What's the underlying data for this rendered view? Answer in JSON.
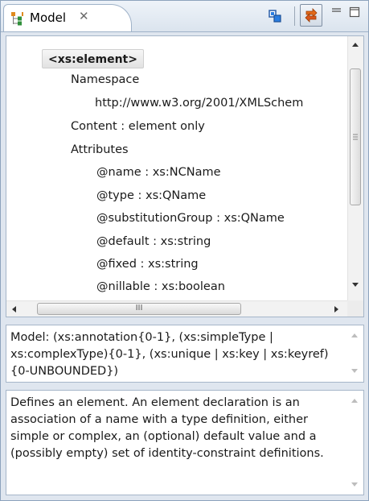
{
  "window": {
    "tab_title": "Model",
    "tab_close_glyph": "✕",
    "tab_icon": "model-tree-icon"
  },
  "toolbar": {
    "link_icon": "link-with-editor-icon",
    "sync_icon": "synchronize-icon",
    "minimize_icon": "minimize-icon",
    "maximize_icon": "maximize-icon"
  },
  "tree": {
    "root": "<xs:element>",
    "namespace_label": "Namespace",
    "namespace_value": "http://www.w3.org/2001/XMLSchem",
    "content": "Content : element only",
    "attributes_label": "Attributes",
    "attributes": [
      "@name : xs:NCName",
      "@type : xs:QName",
      "@substitutionGroup : xs:QName",
      "@default : xs:string",
      "@fixed : xs:string",
      "@nillable : xs:boolean"
    ],
    "hscroll_grip": "III"
  },
  "model_text": "Model: (xs:annotation{0-1}, (xs:simpleType | xs:complexType){0-1}, (xs:unique | xs:key | xs:keyref){0-UNBOUNDED})",
  "doc_text": "Defines an element. An element declaration is an association of a name with a type definition, either simple or complex, an (optional) default value and a (possibly empty) set of identity-constraint definitions.",
  "colors": {
    "accent": "#3a6ea5",
    "panel_bg": "#dfe6ef",
    "border": "#a6b6c9"
  }
}
